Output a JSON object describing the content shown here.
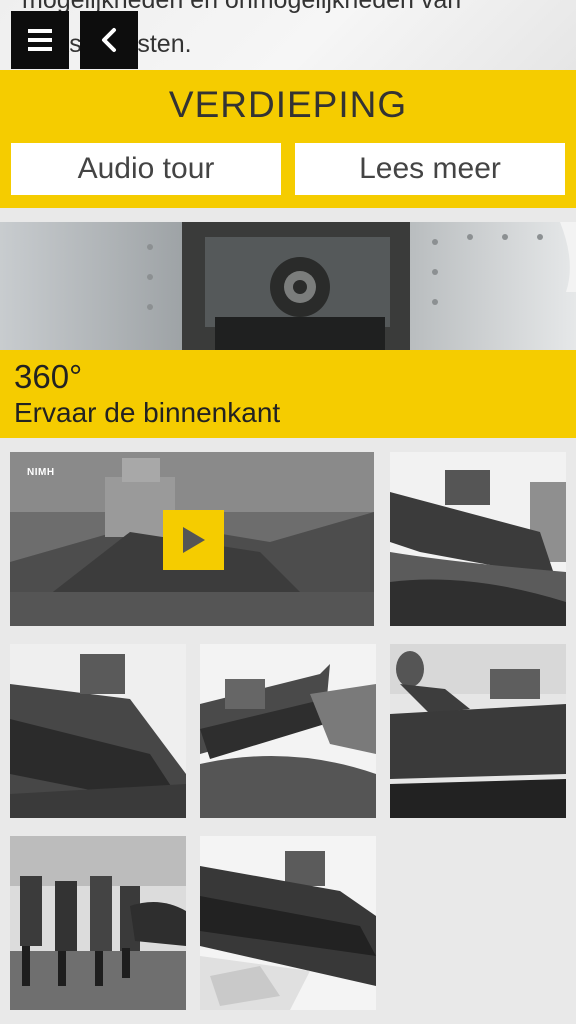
{
  "top": {
    "line1": "mogelijkheden en onmogelijkheden van",
    "line2": "tanks te testen."
  },
  "nav": {
    "menu_icon": "hamburger-icon",
    "back_icon": "chevron-left-icon"
  },
  "verdieping": {
    "title": "VERDIEPING",
    "audio_label": "Audio tour",
    "lees_label": "Lees meer"
  },
  "pano": {
    "degrees": "360°",
    "subtitle": "Ervaar de binnenkant"
  },
  "video": {
    "watermark": "NIMH"
  },
  "colors": {
    "accent": "#f5cc00",
    "background": "#e9e9e9",
    "nav": "#0d0d0d"
  }
}
